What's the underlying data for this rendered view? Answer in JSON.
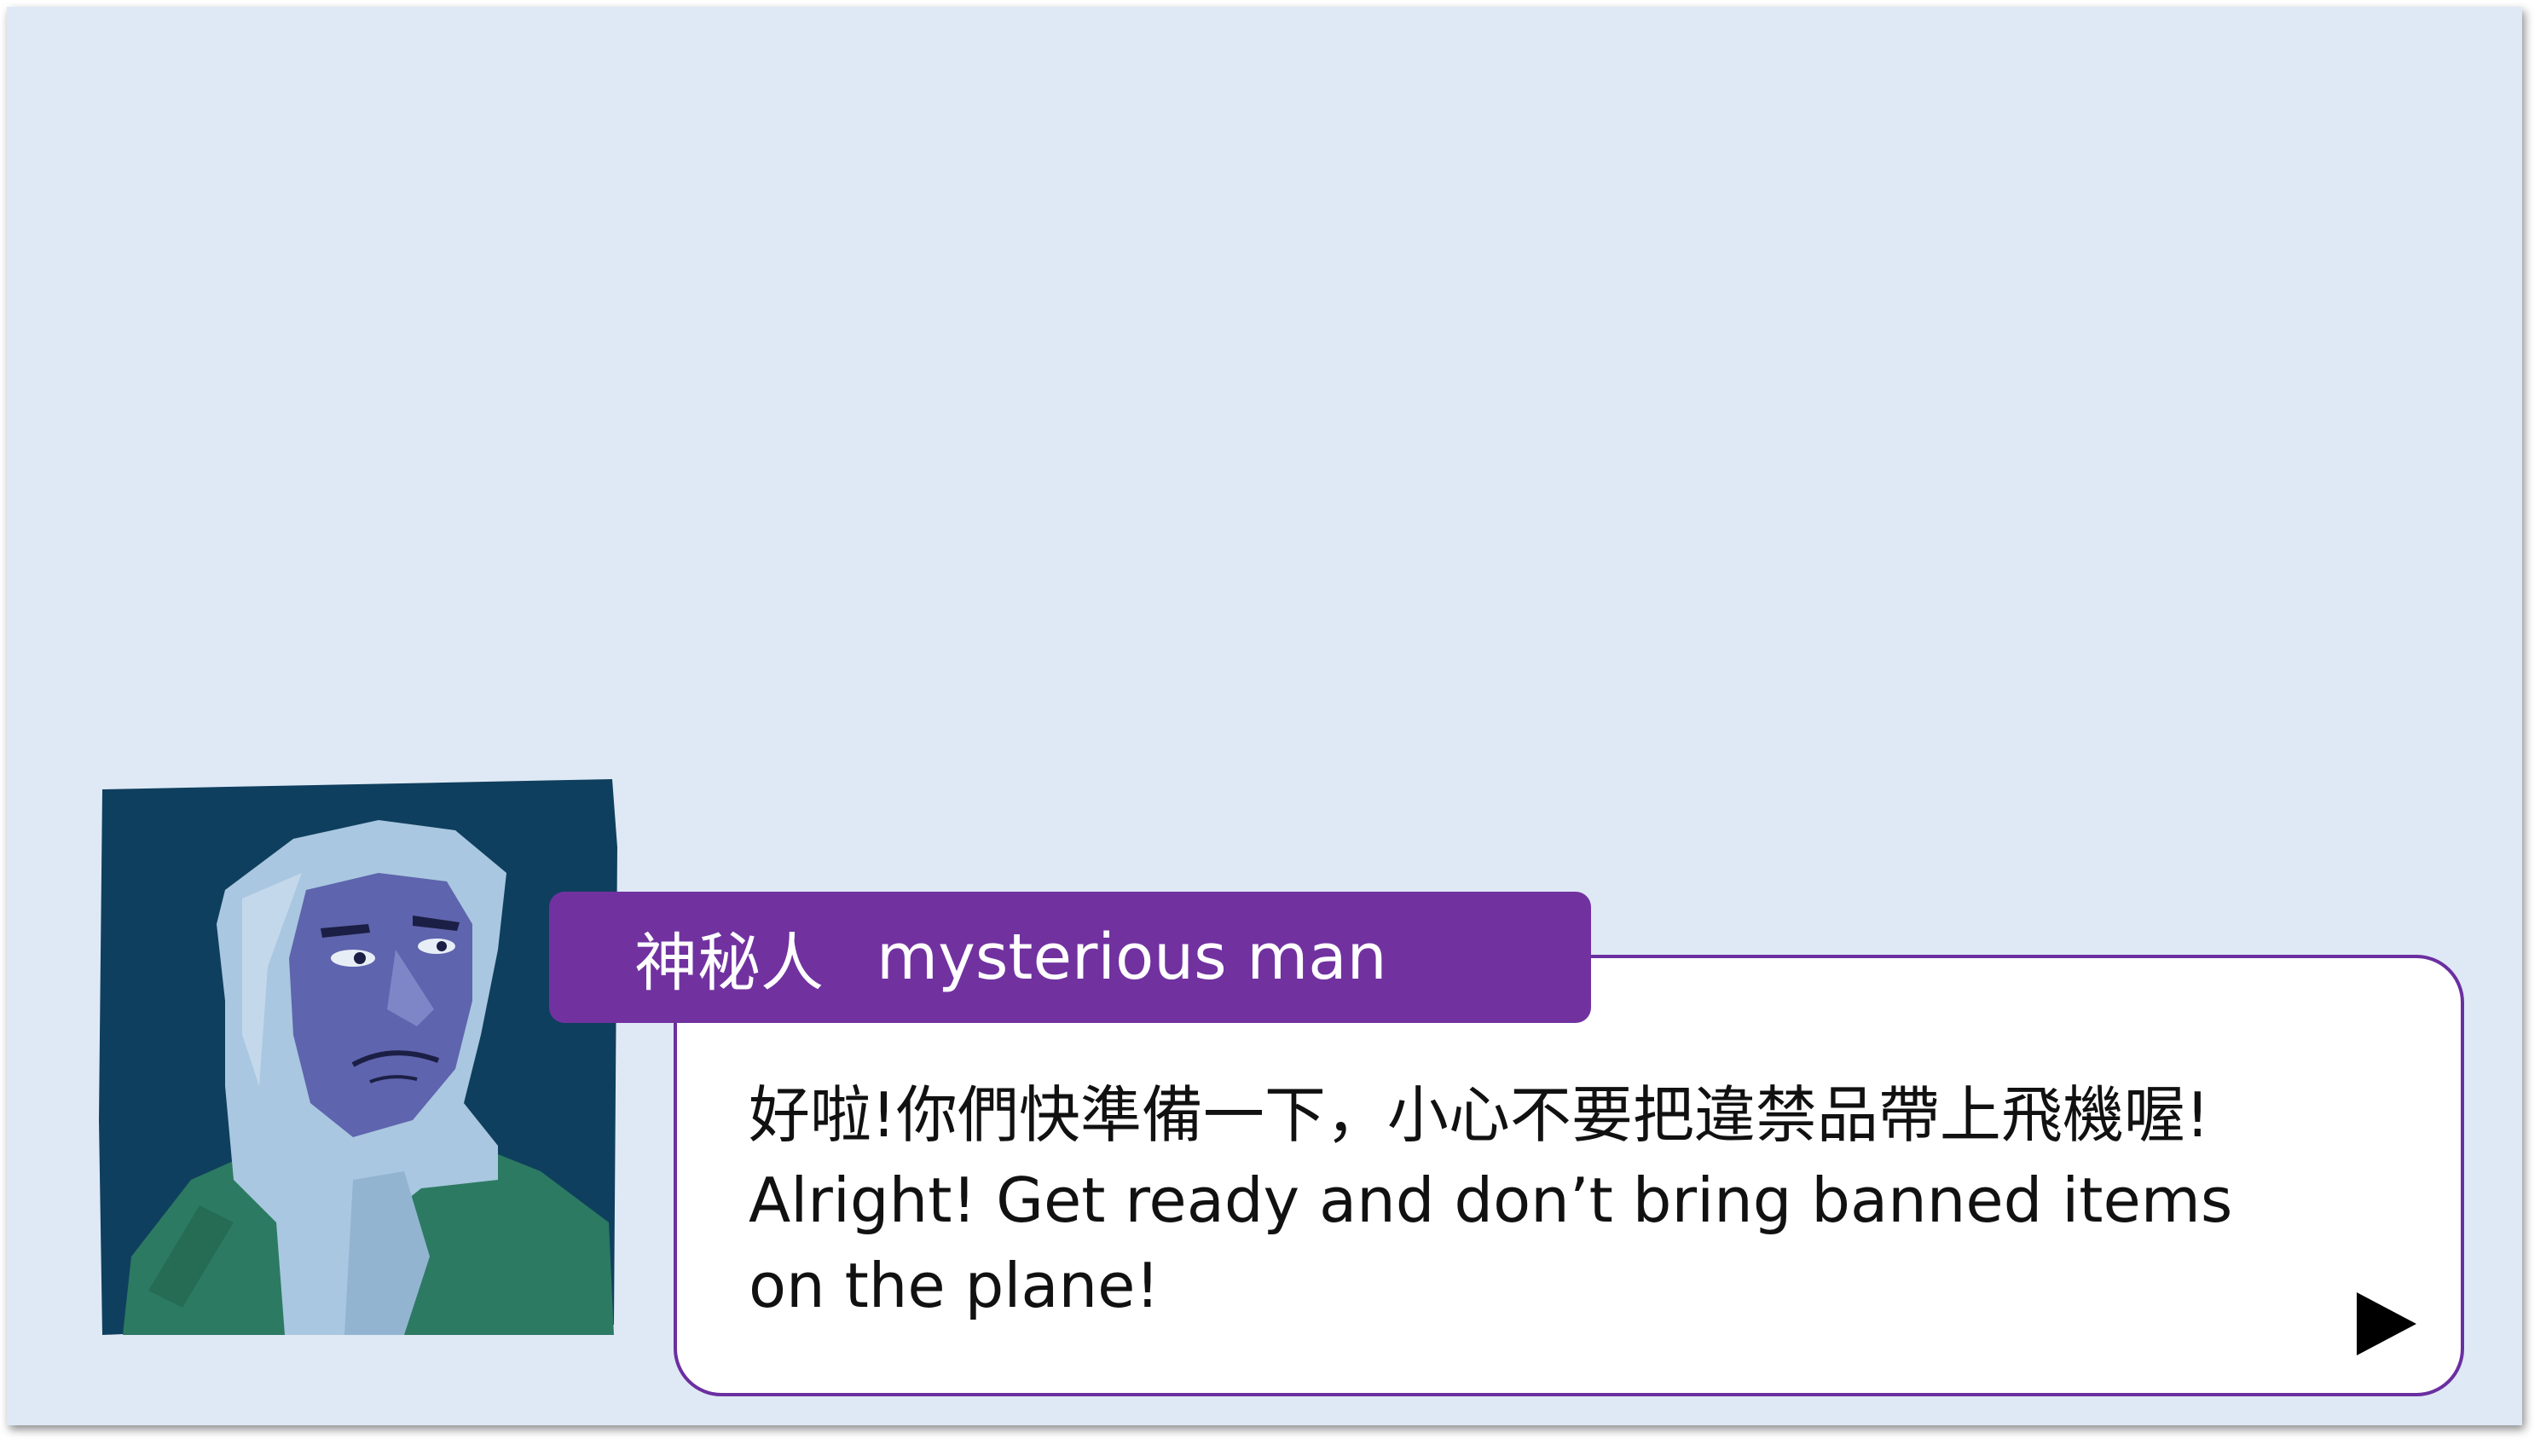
{
  "scene": {
    "background_color": "#dfe9f5"
  },
  "portrait": {
    "character": "mysterious-man",
    "colors": {
      "background": "#0f3f5e",
      "scarf": "#a9c7e0",
      "face": "#5e64ad",
      "coat": "#2c7a62"
    }
  },
  "speaker": {
    "name_zh": "神秘人",
    "name_en": "mysterious man",
    "tag_color": "#7132a0"
  },
  "dialog": {
    "line_zh": "好啦!你們快準備一下，小心不要把違禁品帶上飛機喔!",
    "line_en_1": "Alright! Get ready and don’t bring banned items",
    "line_en_2": "on the plane!",
    "border_color": "#6b2fa0"
  },
  "controls": {
    "next_icon": "play-triangle-icon"
  }
}
